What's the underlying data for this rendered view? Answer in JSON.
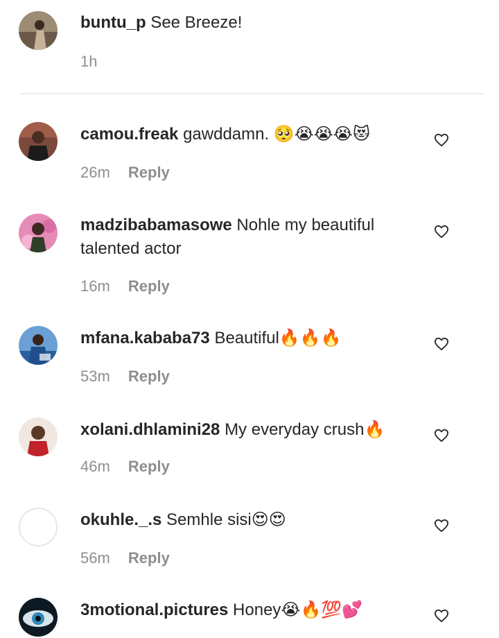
{
  "comments": [
    {
      "username": "buntu_p",
      "text": "See Breeze!",
      "emoji": "",
      "time": "1h",
      "reply": "",
      "avatar_icon": "avatar-photo",
      "like_icon": ""
    },
    {
      "username": "camou.freak",
      "text": "gawddamn.",
      "emoji": "🥺😭😭😭😻",
      "time": "26m",
      "reply": "Reply",
      "avatar_icon": "avatar-photo",
      "like_icon": "heart-outline"
    },
    {
      "username": "madzibabamasowe",
      "text": "Nohle my beautiful talented actor",
      "emoji": "",
      "time": "16m",
      "reply": "Reply",
      "avatar_icon": "avatar-photo",
      "like_icon": "heart-outline"
    },
    {
      "username": "mfana.kababa73",
      "text": "Beautiful",
      "emoji": "🔥🔥🔥",
      "time": "53m",
      "reply": "Reply",
      "avatar_icon": "avatar-photo",
      "like_icon": "heart-outline"
    },
    {
      "username": "xolani.dhlamini28",
      "text": "My everyday crush",
      "emoji": "🔥",
      "time": "46m",
      "reply": "Reply",
      "avatar_icon": "avatar-photo",
      "like_icon": "heart-outline"
    },
    {
      "username": "okuhle._.s",
      "text": "Semhle sisi",
      "emoji": "😍😍",
      "time": "56m",
      "reply": "Reply",
      "avatar_icon": "avatar-default",
      "like_icon": "heart-outline"
    },
    {
      "username": "3motional.pictures",
      "text": "Honey",
      "emoji": "😭🔥💯💕",
      "time": "",
      "reply": "",
      "avatar_icon": "avatar-eye-photo",
      "like_icon": "heart-outline"
    }
  ],
  "colors": {
    "text": "#262626",
    "meta": "#8e8e8e",
    "divider": "#ebebeb"
  }
}
